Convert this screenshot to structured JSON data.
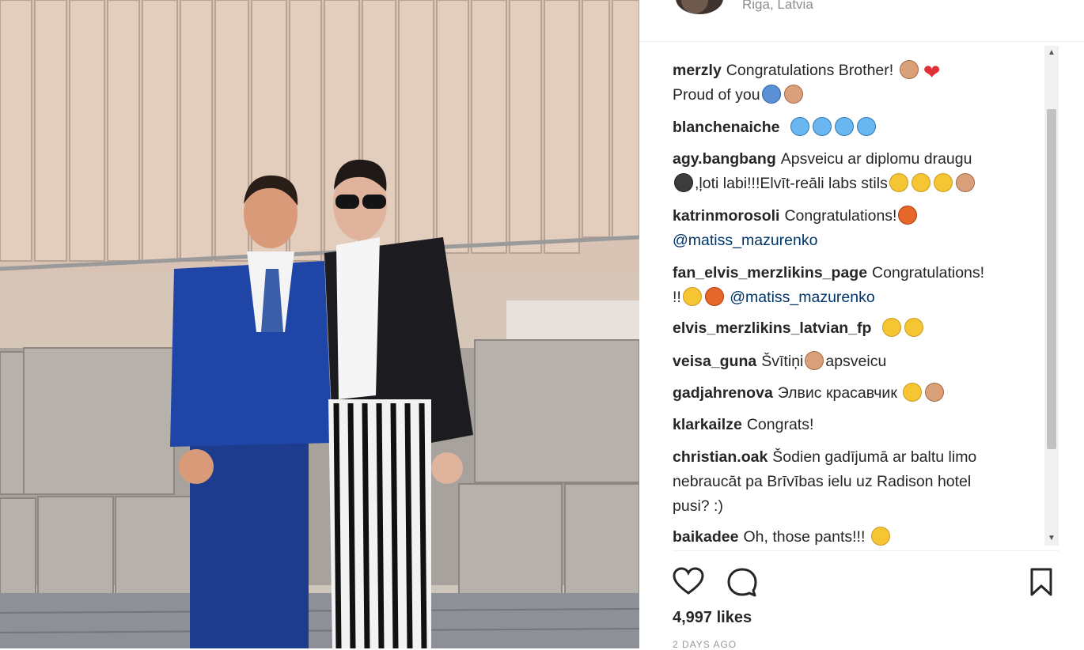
{
  "post": {
    "location": "Riga, Latvia",
    "likes": "4,997 likes",
    "time_ago": "2 DAYS AGO"
  },
  "comments": [
    {
      "user": "merzly",
      "text": "Congratulations Brother!",
      "emojis": [
        "fist",
        "heart"
      ],
      "line2": "Proud of you",
      "line2_emojis": [
        "medal",
        "ok-hand"
      ]
    },
    {
      "user": "blanchenaiche",
      "text": "",
      "emojis": [
        "scream",
        "scream",
        "scream",
        "scream"
      ]
    },
    {
      "user": "agy.bangbang",
      "text": "Apsveicu ar diplomu draugu",
      "line2_prefix_emojis": [
        "graduation-cap"
      ],
      "line2": ",ļoti labi!!!Elvīt-reāli labs stils",
      "line2_emojis": [
        "grin",
        "sunglasses",
        "party",
        "thumbs-up"
      ]
    },
    {
      "user": "katrinmorosoli",
      "text": "Congratulations!",
      "emojis": [
        "collision"
      ],
      "line2_mention": "@matiss_mazurenko"
    },
    {
      "user": "fan_elvis_merzlikins_page",
      "text": "Congratulations!",
      "line2": "!!",
      "line2_emojis": [
        "muscle",
        "collision"
      ],
      "line2_mention": "@matiss_mazurenko"
    },
    {
      "user": "elvis_merzlikins_latvian_fp",
      "text": "",
      "emojis": [
        "clap",
        "sun"
      ]
    },
    {
      "user": "veisa_guna",
      "text_before": "Švītiņi",
      "emojis": [
        "ok-hand"
      ],
      "text_after": "apsveicu"
    },
    {
      "user": "gadjahrenova",
      "text": "Элвис красавчик",
      "emojis": [
        "grin",
        "ok-hand"
      ]
    },
    {
      "user": "klarkailze",
      "text": "Congrats!"
    },
    {
      "user": "christian.oak",
      "text": "Šodien gadījumā ar baltu limo",
      "line2": "nebraucāt pa Brīvības ielu uz Radison hotel",
      "line3": "pusi? :)"
    },
    {
      "user": "baikadee",
      "text": "Oh, those pants!!!",
      "emojis": [
        "heart-eyes"
      ]
    }
  ],
  "icons": {
    "like": "heart-outline-icon",
    "comment": "comment-bubble-icon",
    "save": "bookmark-icon"
  },
  "colors": {
    "username": "#262626",
    "mention": "#003569",
    "secondary": "#8e8e8e"
  }
}
